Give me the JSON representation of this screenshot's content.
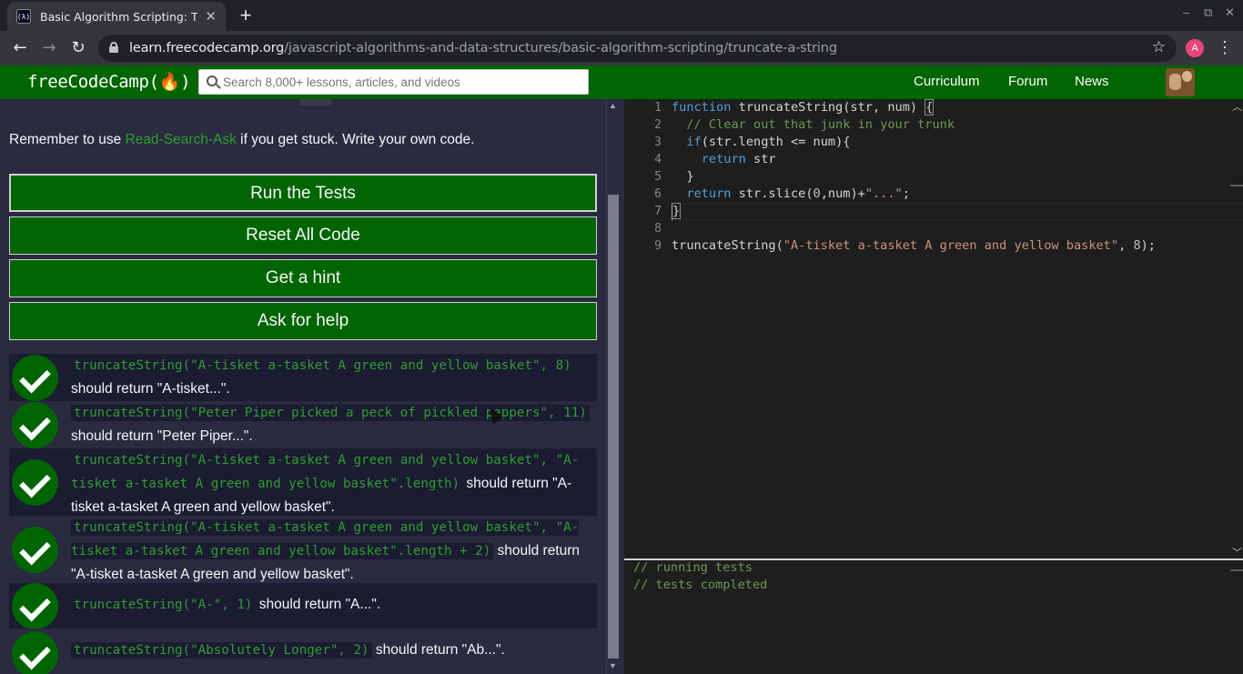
{
  "browser": {
    "tab_title": "Basic Algorithm Scripting: Trunc",
    "favicon_text": "(λ)",
    "new_tab": "+",
    "url_host": "learn.freecodecamp.org",
    "url_path": "/javascript-algorithms-and-data-structures/basic-algorithm-scripting/truncate-a-string",
    "profile_initial": "A"
  },
  "nav": {
    "logo": "freeCodeCamp(🔥)",
    "search_placeholder": "Search 8,000+ lessons, articles, and videos",
    "links": [
      "Curriculum",
      "Forum",
      "News"
    ]
  },
  "left": {
    "remember_pre": "Remember to use ",
    "remember_link": "Read-Search-Ask",
    "remember_post": " if you get stuck. Write your own code.",
    "buttons": [
      "Run the Tests",
      "Reset All Code",
      "Get a hint",
      "Ask for help"
    ],
    "tests": [
      {
        "code": "truncateString(\"A-tisket a-tasket A green and yellow basket\", 8)",
        "text": " should return \"A-tisket...\"."
      },
      {
        "code": "truncateString(\"Peter Piper picked a peck of pickled peppers\", 11)",
        "text": " should return \"Peter Piper...\"."
      },
      {
        "code": "truncateString(\"A-tisket a-tasket A green and yellow basket\", \"A-tisket a-tasket A green and yellow basket\".length)",
        "text": " should return \"A-tisket a-tasket A green and yellow basket\"."
      },
      {
        "code": "truncateString(\"A-tisket a-tasket A green and yellow basket\", \"A-tisket a-tasket A green and yellow basket\".length + 2)",
        "text": " should return \"A-tisket a-tasket A green and yellow basket\"."
      },
      {
        "code": "truncateString(\"A-\", 1)",
        "text": " should return \"A...\"."
      },
      {
        "code": "truncateString(\"Absolutely Longer\", 2)",
        "text": " should return \"Ab...\"."
      }
    ]
  },
  "editor": {
    "line_numbers": [
      "1",
      "2",
      "3",
      "4",
      "5",
      "6",
      "7",
      "8",
      "9"
    ]
  },
  "console": {
    "lines": [
      "// running tests",
      "// tests completed"
    ]
  }
}
